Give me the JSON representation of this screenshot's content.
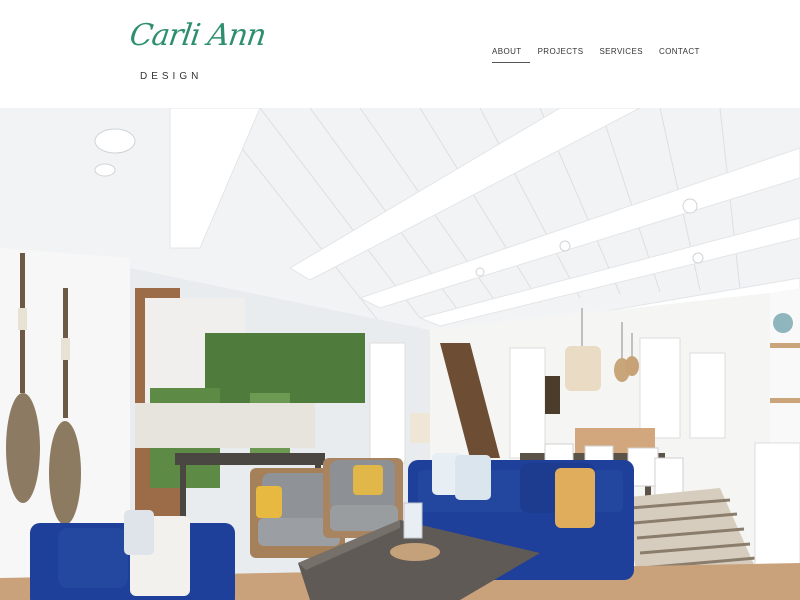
{
  "brand": {
    "script": "Carli Ann",
    "sub": "DESIGN"
  },
  "nav": {
    "items": [
      {
        "label": "ABOUT",
        "active": true
      },
      {
        "label": "PROJECTS",
        "active": false
      },
      {
        "label": "SERVICES",
        "active": false
      },
      {
        "label": "CONTACT",
        "active": false
      }
    ]
  },
  "colors": {
    "brand_green": "#2e8f6f",
    "sofa_blue": "#1e3f9a"
  },
  "hero": {
    "subject": "coastal-living-room-photo"
  }
}
